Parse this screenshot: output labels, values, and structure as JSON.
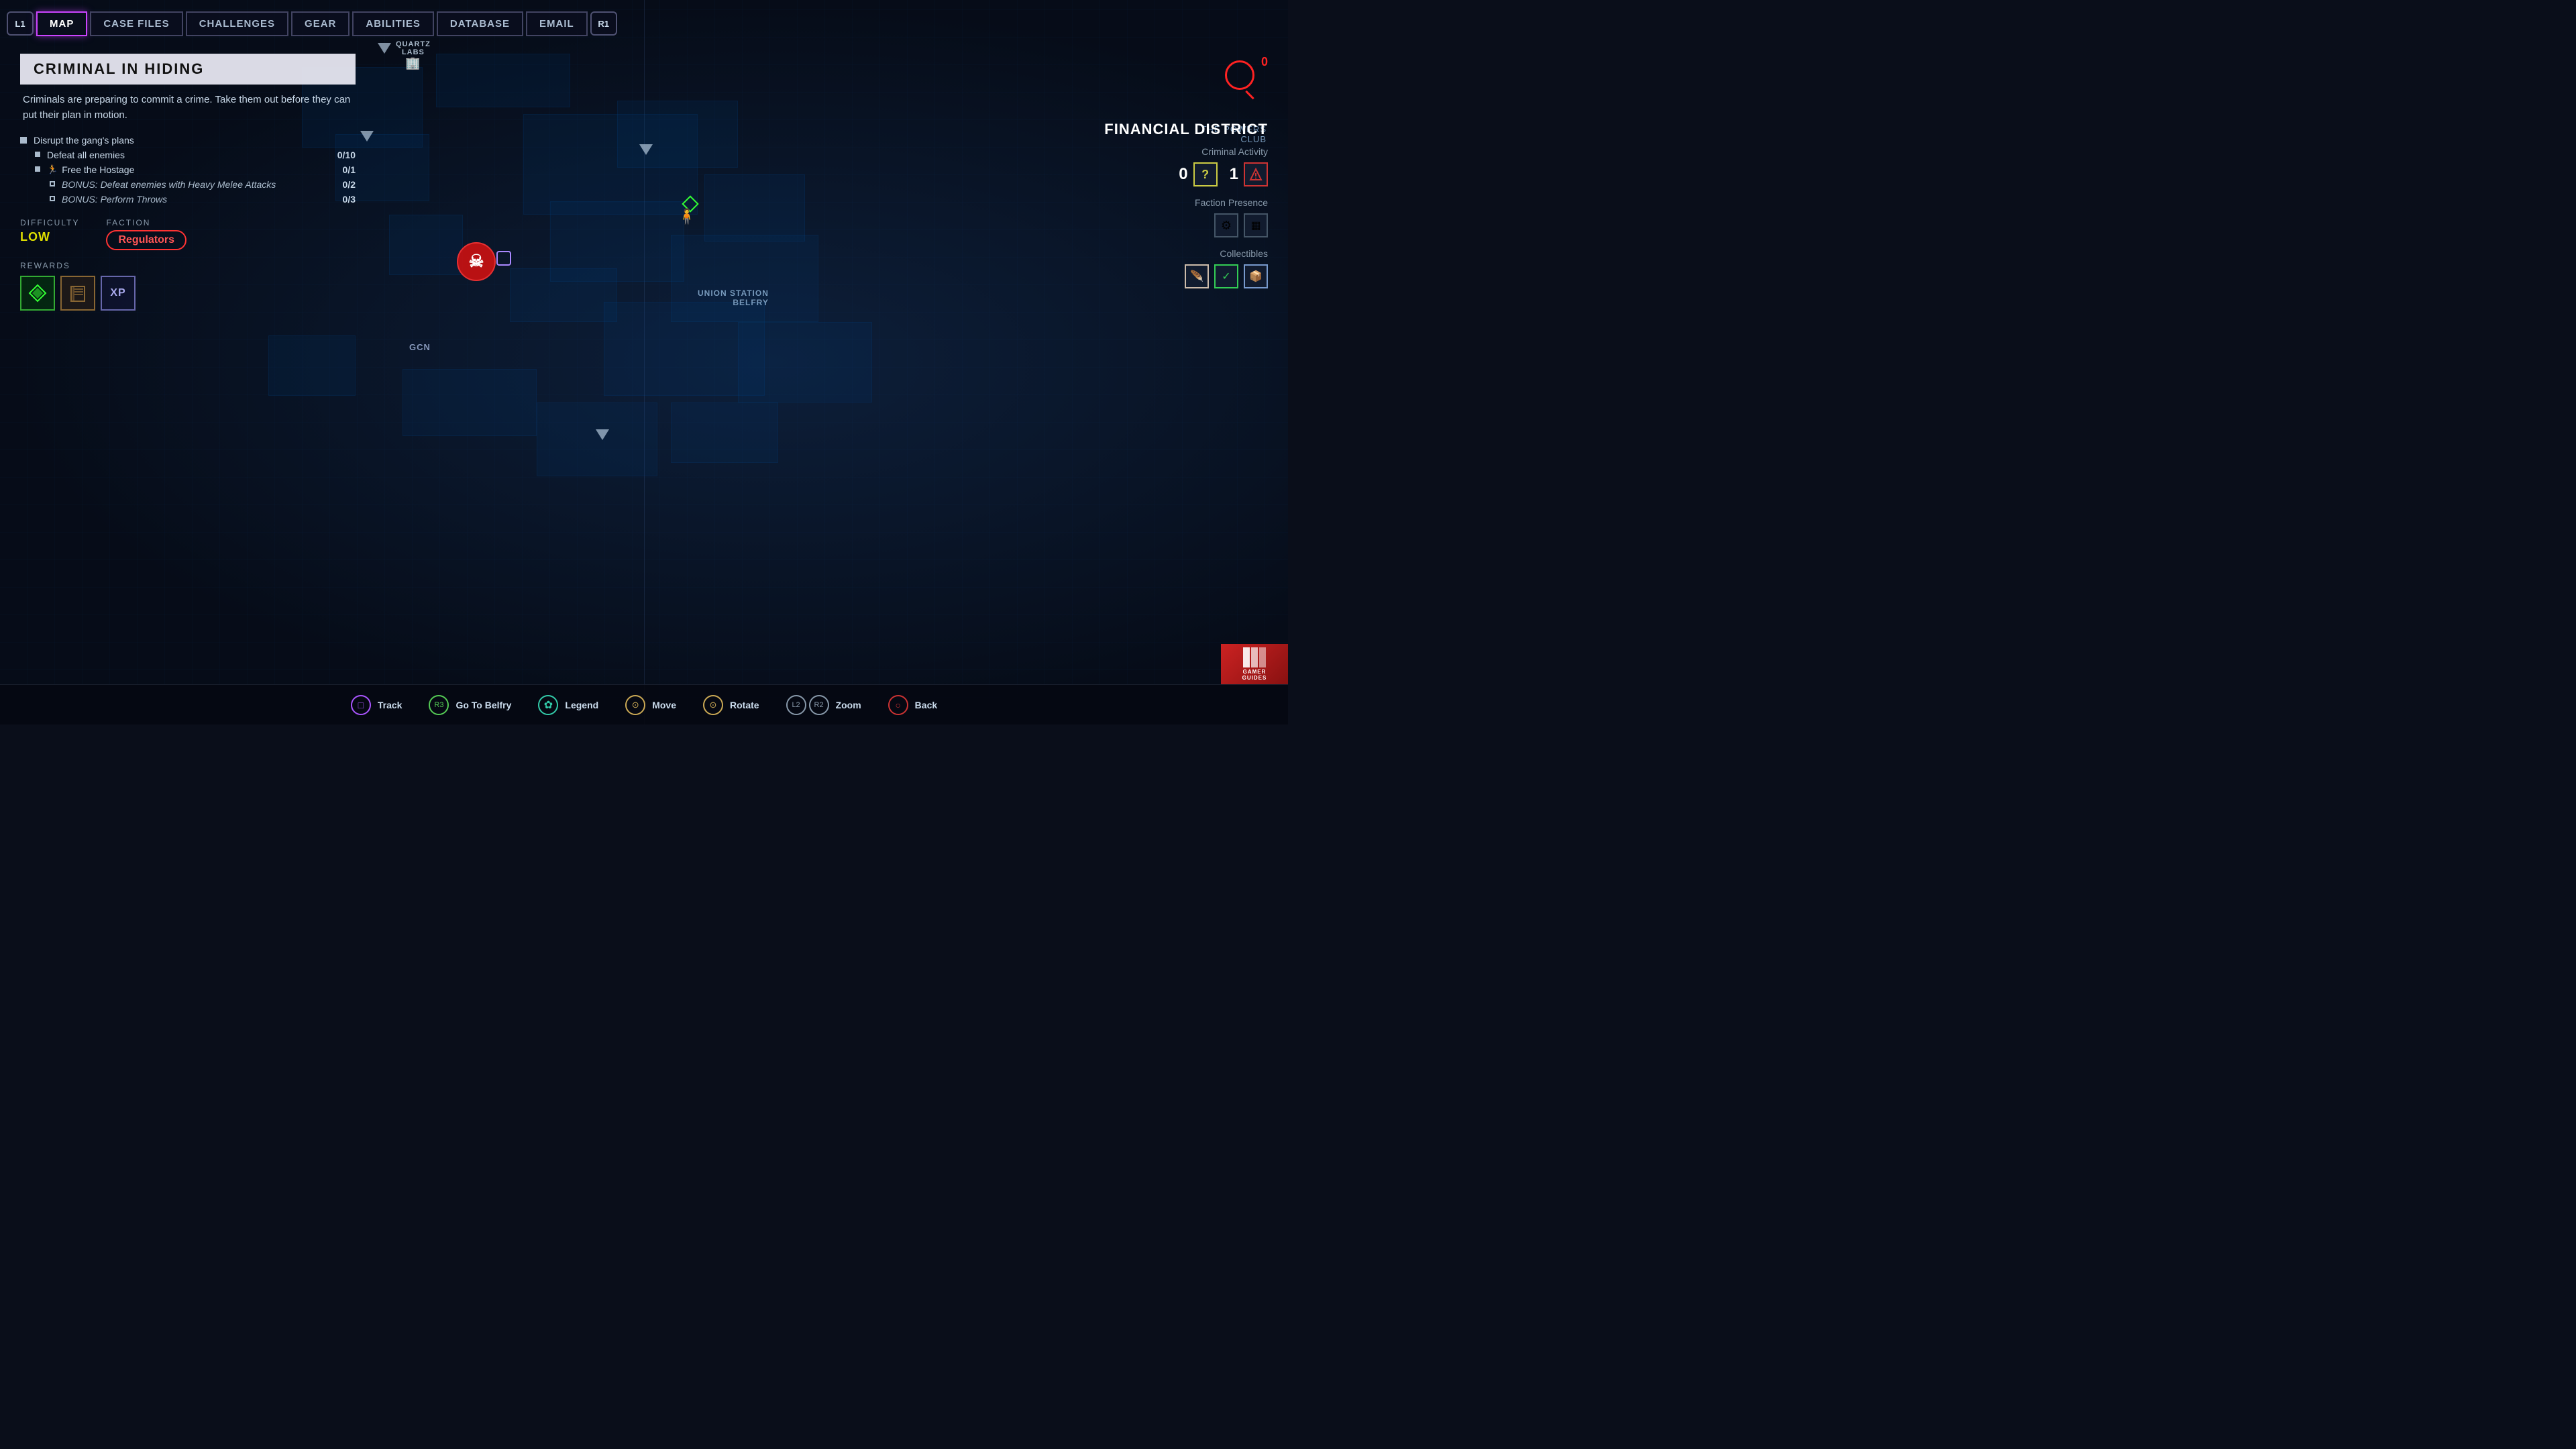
{
  "nav": {
    "l1": "L1",
    "r1": "R1",
    "active_tab": "MAP",
    "tabs": [
      "MAP",
      "CASE FILES",
      "CHALLENGES",
      "GEAR",
      "ABILITIES",
      "DATABASE",
      "EMAIL"
    ]
  },
  "mission": {
    "title": "CRIMINAL IN HIDING",
    "description": "Criminals are preparing to commit a crime. Take them out before they can put their plan in motion.",
    "objectives": [
      {
        "text": "Disrupt the gang's plans",
        "count": "",
        "indent": 0,
        "style": "filled",
        "icon": ""
      },
      {
        "text": "Defeat all enemies",
        "count": "0/10",
        "indent": 1,
        "style": "filled",
        "icon": ""
      },
      {
        "text": "Free the Hostage",
        "count": "0/1",
        "indent": 1,
        "style": "filled",
        "icon": "🏃"
      },
      {
        "text": "BONUS: Defeat enemies with Heavy Melee Attacks",
        "count": "0/2",
        "indent": 2,
        "style": "outline",
        "icon": ""
      },
      {
        "text": "BONUS: Perform Throws",
        "count": "0/3",
        "indent": 2,
        "style": "outline",
        "icon": ""
      }
    ],
    "difficulty_label": "DIFFICULTY",
    "difficulty_value": "LOW",
    "faction_label": "FACTION",
    "faction_value": "Regulators",
    "rewards_label": "Rewards",
    "reward_icons": [
      "◈",
      "📚",
      "XP"
    ]
  },
  "map": {
    "location_labels": [
      {
        "id": "union_station",
        "text": "UNION STATION\nBELFRY"
      },
      {
        "id": "gcn",
        "text": "GCN"
      },
      {
        "id": "quartz_labs",
        "text": "QUARTZ\nLABS"
      },
      {
        "id": "powers_club",
        "text": "THE POWERS\nCLUB"
      }
    ]
  },
  "right_panel": {
    "district_name": "FINANCIAL DISTRICT",
    "criminal_activity_label": "Criminal Activity",
    "criminal_activity_unknown": "0",
    "criminal_activity_question": "?",
    "criminal_activity_exclaim": "1",
    "faction_presence_label": "Faction Presence",
    "collectibles_label": "Collectibles",
    "search_count": "0"
  },
  "bottom_bar": {
    "actions": [
      {
        "id": "track",
        "button_symbol": "□",
        "button_type": "purple",
        "label": "Track"
      },
      {
        "id": "go_to_belfry",
        "button_symbol": "R3",
        "button_type": "green",
        "label": "Go To Belfry"
      },
      {
        "id": "legend",
        "button_symbol": "✿",
        "button_type": "flower",
        "label": "Legend"
      },
      {
        "id": "move",
        "button_symbol": "L",
        "button_type": "l-circle",
        "label": "Move"
      },
      {
        "id": "rotate",
        "button_symbol": "R",
        "button_type": "r-circle",
        "label": "Rotate"
      },
      {
        "id": "zoom",
        "button_symbol1": "L2",
        "button_symbol2": "R2",
        "label": "Zoom"
      },
      {
        "id": "back",
        "button_symbol": "○",
        "button_type": "back",
        "label": "Back"
      }
    ]
  },
  "logo": {
    "line1": "GAMER",
    "line2": "GUIDES"
  }
}
